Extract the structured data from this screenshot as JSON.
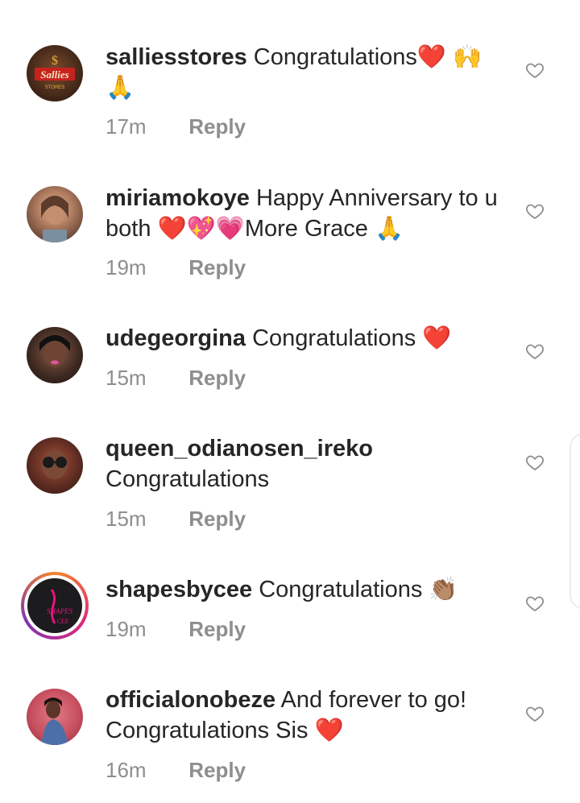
{
  "comments": [
    {
      "username": "salliesstores",
      "text": "Congratulations❤️ 🙌🙏",
      "time": "17m",
      "reply": "Reply",
      "avatar_logo_text": "Sallies"
    },
    {
      "username": "miriamokoye",
      "text": "Happy Anniversary to u both ❤️💖💗More Grace 🙏",
      "time": "19m",
      "reply": "Reply"
    },
    {
      "username": "udegeorgina",
      "text": "Congratulations ❤️",
      "time": "15m",
      "reply": "Reply"
    },
    {
      "username": "queen_odianosen_ireko",
      "text": "Congratulations",
      "time": "15m",
      "reply": "Reply"
    },
    {
      "username": "shapesbycee",
      "text": "Congratulations 👏🏽",
      "time": "19m",
      "reply": "Reply",
      "avatar_logo_text": "SHAPES CEE"
    },
    {
      "username": "officialonobeze",
      "text": "And forever to go! Congratulations Sis ❤️",
      "time": "16m",
      "reply": "Reply"
    }
  ],
  "icons": {
    "like": "heart-outline-icon"
  }
}
